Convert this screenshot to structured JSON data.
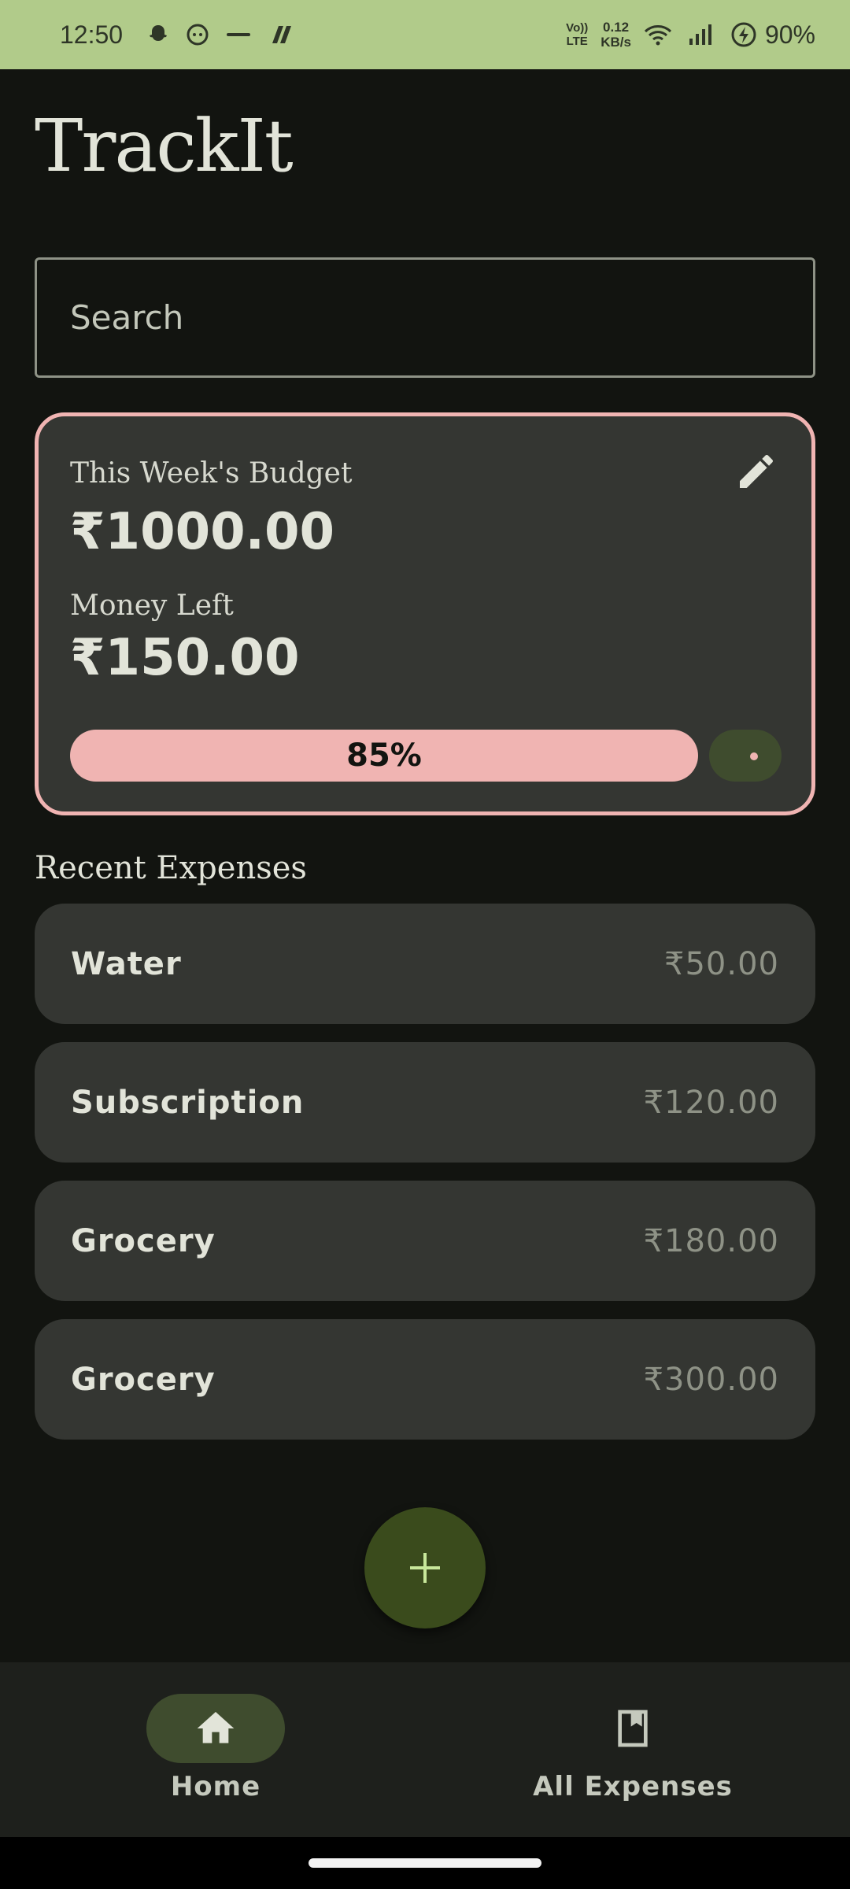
{
  "status_bar": {
    "time": "12:50",
    "network_top": "Vo))",
    "network_bottom": "LTE",
    "speed_value": "0.12",
    "speed_unit": "KB/s",
    "battery": "90%",
    "notification_icons": [
      "snapchat-icon",
      "reddit-icon",
      "zomato-icon",
      "app-icon"
    ]
  },
  "app": {
    "title": "TrackIt"
  },
  "search": {
    "placeholder": "Search"
  },
  "budget": {
    "label": "This Week's Budget",
    "amount": "₹1000.00",
    "left_label": "Money Left",
    "left_amount": "₹150.00",
    "progress_text": "85%",
    "progress_fraction": 0.85
  },
  "recent": {
    "title": "Recent Expenses",
    "items": [
      {
        "name": "Water",
        "amount": "₹50.00"
      },
      {
        "name": "Subscription",
        "amount": "₹120.00"
      },
      {
        "name": "Grocery",
        "amount": "₹180.00"
      },
      {
        "name": "Grocery",
        "amount": "₹300.00"
      }
    ]
  },
  "nav": {
    "items": [
      {
        "label": "Home",
        "icon": "home-icon",
        "active": true
      },
      {
        "label": "All Expenses",
        "icon": "bookmark-icon",
        "active": false
      }
    ]
  },
  "colors": {
    "background": "#121410",
    "status_bar": "#b1cb8a",
    "card": "#343632",
    "accent_pink": "#f0b4b2",
    "fab": "#3a4b1c"
  }
}
